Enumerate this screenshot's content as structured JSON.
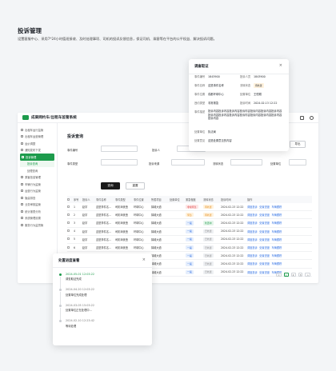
{
  "hero": {
    "title": "投诉管理",
    "desc": "设置客服中心、采用7*24小时值班接收、及时处理事项、司机的投诉反馈信息，保证司机、乘客等在平台的公平权益、解决投诉问题。"
  },
  "app": {
    "name": "成果网约车/出租车监管系统"
  },
  "sidebar": {
    "items": [
      {
        "label": "出租车运行监管"
      },
      {
        "label": "出租车运营管理"
      },
      {
        "label": "运价调整"
      },
      {
        "label": "通知发布下发"
      },
      {
        "label": "投诉管理",
        "active": true
      },
      {
        "label": "投诉查询",
        "sub": true,
        "current": true
      },
      {
        "label": "处理查询",
        "sub": true
      },
      {
        "label": "乘客信息管理"
      },
      {
        "label": "车辆行为监管"
      },
      {
        "label": "运营行为监管"
      },
      {
        "label": "隐患排查"
      },
      {
        "label": "业务审核监管"
      },
      {
        "label": "统计报表分析"
      },
      {
        "label": "系统管理设置"
      },
      {
        "label": "服务行为监督管"
      }
    ]
  },
  "page": {
    "title": "投诉查询",
    "export": "导出",
    "filters": {
      "event_no": "事件编号",
      "reporter": "投诉人",
      "event_type": "事件类型",
      "event_source": "投诉来源",
      "status": "流转状态",
      "handler": "处置单位"
    },
    "search": "查询",
    "reset": "重置"
  },
  "table": {
    "headers": [
      "",
      "序号",
      "投诉人",
      "事件名称",
      "事件类型",
      "事件位置",
      "所属项目",
      "处置单位",
      "紧急程度",
      "流转状态",
      "投诉时间",
      "操作"
    ],
    "rows": [
      {
        "no": "1",
        "reporter": "赵宇",
        "name": "这是事件名...",
        "type": "司机驾驶违",
        "pos": "环球中心",
        "proj": "锦城大道",
        "urgency": "非常紧急",
        "urg_tag": "red",
        "status": "待处置",
        "st_tag": "orange",
        "time": "2024.02.23 12:22"
      },
      {
        "no": "2",
        "reporter": "赵宇",
        "name": "这是事件名...",
        "type": "司机驾驶违",
        "pos": "环球中心",
        "proj": "锦城大道",
        "urgency": "紧急",
        "urg_tag": "orange",
        "status": "待处置",
        "st_tag": "orange",
        "time": "2024.02.23 12:22"
      },
      {
        "no": "3",
        "reporter": "赵宇",
        "name": "这是事件名...",
        "type": "司机驾驶违",
        "pos": "环球中心",
        "proj": "锦城大道",
        "urgency": "一般",
        "urg_tag": "blue",
        "status": "处置中",
        "st_tag": "green",
        "time": "2024.02.23 12:22"
      },
      {
        "no": "4",
        "reporter": "赵宇",
        "name": "这是事件名...",
        "type": "司机驾驶违",
        "pos": "环球中心",
        "proj": "锦城大道",
        "urgency": "一般",
        "urg_tag": "blue",
        "status": "已处置",
        "st_tag": "gray",
        "time": "2024.02.23 12:22"
      },
      {
        "no": "5",
        "reporter": "赵宇",
        "name": "这是事件名...",
        "type": "司机驾驶违",
        "pos": "环球中心",
        "proj": "锦城大道",
        "urgency": "一般",
        "urg_tag": "blue",
        "status": "已处置",
        "st_tag": "gray",
        "time": "2024.02.23 12:22"
      },
      {
        "no": "6",
        "reporter": "赵宇",
        "name": "这是事件名...",
        "type": "司机驾驶违",
        "pos": "环球中心",
        "proj": "锦城大道",
        "urgency": "一般",
        "urg_tag": "blue",
        "status": "已处置",
        "st_tag": "gray",
        "time": "2024.02.23 12:22"
      },
      {
        "no": "7",
        "reporter": "赵宇",
        "name": "这是事件名...",
        "type": "司机驾驶违",
        "pos": "环球中心",
        "proj": "锦城大道",
        "urgency": "一般",
        "urg_tag": "blue",
        "status": "已处置",
        "st_tag": "gray",
        "time": "2024.02.23 12:22"
      },
      {
        "no": "8",
        "reporter": "赵宇",
        "name": "这是事件名...",
        "type": "司机驾驶违",
        "pos": "环球中心",
        "proj": "锦城大道",
        "urgency": "一般",
        "urg_tag": "blue",
        "status": "已处置",
        "st_tag": "gray",
        "time": "2024.02.23 12:22"
      },
      {
        "no": "9",
        "reporter": "赵宇",
        "name": "这是事件名...",
        "type": "司机驾驶违",
        "pos": "环球中心",
        "proj": "锦城大道",
        "urgency": "一般",
        "urg_tag": "blue",
        "status": "已处置",
        "st_tag": "gray",
        "time": "2024.02.23 12:22"
      }
    ],
    "ops": [
      "调度投诉",
      "处置进度",
      "车辆跟踪"
    ]
  },
  "pager": {
    "prev": "<",
    "pages": [
      "1",
      "2",
      "3"
    ],
    "next": ">"
  },
  "detail": {
    "title": "调查取证",
    "close": "×",
    "fields": {
      "event_no_k": "事件编号",
      "event_no_v": "1843900",
      "reporter_k": "投诉人员",
      "reporter_v": "1843900",
      "name_k": "事件名称",
      "name_v": "这是事件名称",
      "status_k": "流转状态",
      "status_v": "待处置",
      "pos_k": "事件位置",
      "pos_v": "成都环球中心",
      "handler_k": "处置单位",
      "handler_v": "王恒刚",
      "type_k": "违约类型",
      "type_v": "非常紧急",
      "time_k": "投诉时间",
      "time_v": "2024.02.13 12:22",
      "desc_k": "事件描述",
      "desc_v": "投诉内容投诉内容投诉内容投诉内容投诉内容投诉内容投诉内容投诉内容投诉内容投诉内容投诉内容投诉内容投诉内容投诉内容投诉内容",
      "unit_k": "处置单位",
      "unit_v": "执法局",
      "opinion_k": "处置意见",
      "opinion_v": "这是处置意见的内容"
    }
  },
  "progress": {
    "title": "处置进度查看",
    "close": "×",
    "items": [
      {
        "time": "2024-05-01 12:03:22",
        "text": "调查取证完成"
      },
      {
        "time": "2024-04-20 12:03:22",
        "text": "处置单位完成处理"
      },
      {
        "time": "2024-03-05 15:03:22",
        "text": "处置单位正在处理中..."
      },
      {
        "time": "2024-02-10 12:23:42",
        "text": "等待处理"
      }
    ]
  },
  "colors": {
    "brand": "#1d9b4c",
    "link": "#3473e4",
    "danger": "#e04646",
    "warn": "#e58a17"
  }
}
